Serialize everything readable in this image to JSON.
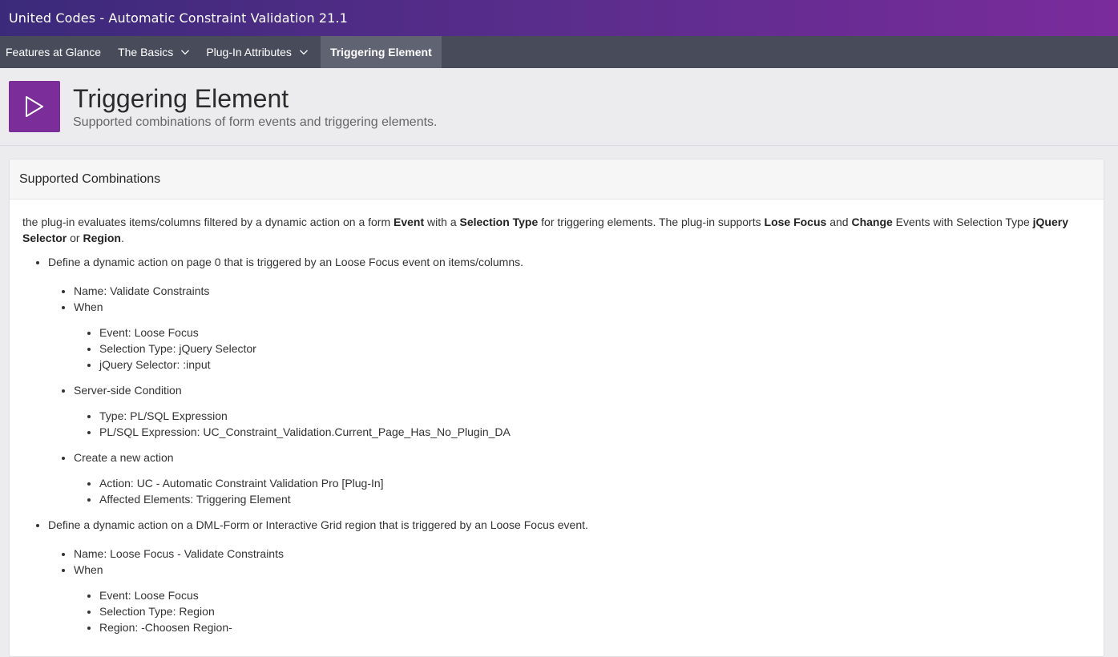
{
  "app": {
    "title": "United Codes - Automatic Constraint Validation 21.1"
  },
  "nav": {
    "items": [
      {
        "label": "Features at Glance",
        "has_menu": false
      },
      {
        "label": "The Basics",
        "has_menu": true
      },
      {
        "label": "Plug-In Attributes",
        "has_menu": true
      },
      {
        "label": "Triggering Element",
        "has_menu": false,
        "active": true
      }
    ]
  },
  "hero": {
    "icon": "play-icon",
    "title": "Triggering Element",
    "subtitle": "Supported combinations of form events and triggering elements."
  },
  "region": {
    "title": "Supported Combinations",
    "intro": {
      "t1": "the plug-in evaluates items/columns filtered by a dynamic action on a form ",
      "b1": "Event",
      "t2": " with a ",
      "b2": "Selection Type",
      "t3": " for triggering elements. The plug-in supports ",
      "b3": "Lose Focus",
      "t4": " and ",
      "b4": "Change",
      "t5": " Events with Selection Type ",
      "b5": "jQuery Selector",
      "t6": " or ",
      "b6": "Region",
      "t7": "."
    },
    "list": [
      {
        "text": "Define a dynamic action on page 0 that is triggered by an Loose Focus event on items/columns.",
        "name": "Name: Validate Constraints",
        "when": "When",
        "when_items": [
          "Event: Loose Focus",
          "Selection Type: jQuery Selector",
          "jQuery Selector: :input"
        ],
        "server": "Server-side Condition",
        "server_items": [
          "Type: PL/SQL Expression",
          "PL/SQL Expression: UC_Constraint_Validation.Current_Page_Has_No_Plugin_DA"
        ],
        "action": "Create a new action",
        "action_items": [
          "Action: UC - Automatic Constraint Validation Pro [Plug-In]",
          "Affected Elements: Triggering Element"
        ]
      },
      {
        "text": "Define a dynamic action on a DML-Form or Interactive Grid region that is triggered by an Loose Focus event.",
        "name": "Name: Loose Focus - Validate Constraints",
        "when": "When",
        "when_items": [
          "Event: Loose Focus",
          "Selection Type: Region",
          "Region: -Choosen Region-"
        ]
      }
    ]
  }
}
